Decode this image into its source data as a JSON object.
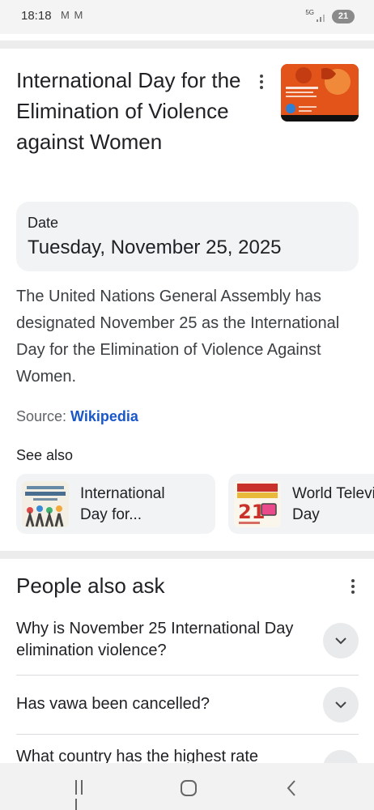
{
  "status_bar": {
    "time": "18:18",
    "mail_icons": "M M",
    "network": "5G",
    "battery": "21"
  },
  "knowledge_panel": {
    "title": "International Day for the Elimination of Violence against Women",
    "image_icon": "event-poster-thumbnail",
    "date_label": "Date",
    "date_value": "Tuesday, November 25, 2025",
    "description": "The United Nations General Assembly has designated November 25 as the International Day for the Elimination of Violence Against Women.",
    "source_label": "Source: ",
    "source_link": "Wikipedia",
    "see_also_label": "See also",
    "see_also": [
      {
        "label": "International Day for...",
        "line1": "International",
        "line2": "Day for...",
        "image_icon": "tolerance-day-thumbnail"
      },
      {
        "label": "World Television Day",
        "line1": "World Television",
        "line2": "Day",
        "image_icon": "world-television-day-thumbnail"
      }
    ]
  },
  "people_also_ask": {
    "title": "People also ask",
    "questions": [
      {
        "text": "Why is November 25 International Day elimination violence?"
      },
      {
        "text": "Has vawa been cancelled?"
      },
      {
        "text": "What country has the highest rate"
      }
    ]
  },
  "colors": {
    "link": "#1a57c8",
    "card_bg": "#f1f3f4",
    "divider": "#ececec"
  }
}
